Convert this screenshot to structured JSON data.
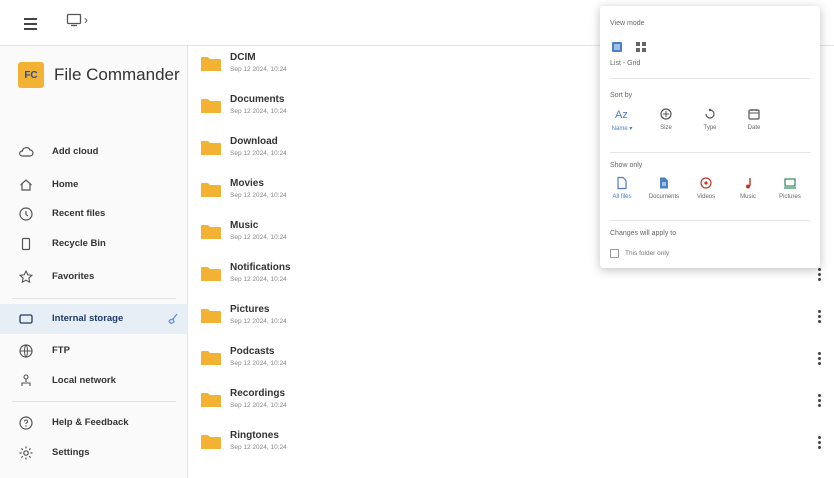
{
  "topbar": {
    "menu_icon": "hamburger-menu-icon",
    "crumb_icon": "device-icon",
    "crumb_sep": "›"
  },
  "brand": {
    "logo_text": "FC",
    "name": "File Commander",
    "logo_color": "#f2b233"
  },
  "sidebar": {
    "items": [
      {
        "label": "Add cloud",
        "icon": "cloud-add-icon"
      },
      {
        "label": "Home",
        "icon": "home-icon"
      },
      {
        "label": "Recent files",
        "icon": "clock-icon"
      },
      {
        "label": "Recycle Bin",
        "icon": "recycle-bin-icon"
      },
      {
        "label": "Favorites",
        "icon": "star-icon"
      },
      {
        "label": "Internal storage",
        "icon": "storage-icon",
        "active": true
      },
      {
        "label": "FTP",
        "icon": "globe-icon"
      },
      {
        "label": "Local network",
        "icon": "network-icon"
      },
      {
        "label": "Help & Feedback",
        "icon": "help-icon"
      },
      {
        "label": "Settings",
        "icon": "gear-icon"
      }
    ]
  },
  "files": [
    {
      "name": "DCIM",
      "date": "Sep 12 2024, 10:24"
    },
    {
      "name": "Documents",
      "date": "Sep 12 2024, 10:24"
    },
    {
      "name": "Download",
      "date": "Sep 12 2024, 10:24"
    },
    {
      "name": "Movies",
      "date": "Sep 12 2024, 10:24"
    },
    {
      "name": "Music",
      "date": "Sep 12 2024, 10:24"
    },
    {
      "name": "Notifications",
      "date": "Sep 12 2024, 10:24"
    },
    {
      "name": "Pictures",
      "date": "Sep 12 2024, 10:24"
    },
    {
      "name": "Podcasts",
      "date": "Sep 12 2024, 10:24"
    },
    {
      "name": "Recordings",
      "date": "Sep 12 2024, 10:24"
    },
    {
      "name": "Ringtones",
      "date": "Sep 12 2024, 10:24"
    }
  ],
  "popup": {
    "view_mode_label": "View mode",
    "view_mode_value": "List - Grid",
    "sort_label": "Sort by",
    "sort_options": [
      {
        "label": "Name ▾",
        "icon": "sort-alpha-icon",
        "selected": true
      },
      {
        "label": "Size",
        "icon": "size-icon"
      },
      {
        "label": "Type",
        "icon": "type-icon"
      },
      {
        "label": "Date",
        "icon": "calendar-icon"
      }
    ],
    "filter_label": "Show only",
    "filter_options": [
      {
        "label": "All files",
        "icon": "file-icon",
        "selected": true,
        "color": "#4a7fc8"
      },
      {
        "label": "Documents",
        "icon": "document-icon",
        "color": "#4a7fc8"
      },
      {
        "label": "Videos",
        "icon": "video-icon",
        "color": "#c0392b"
      },
      {
        "label": "Music",
        "icon": "music-icon",
        "color": "#c0392b"
      },
      {
        "label": "Pictures",
        "icon": "picture-icon",
        "color": "#2e8b57"
      }
    ],
    "apply_label": "Changes will apply to",
    "checkbox_label": "This folder only"
  }
}
